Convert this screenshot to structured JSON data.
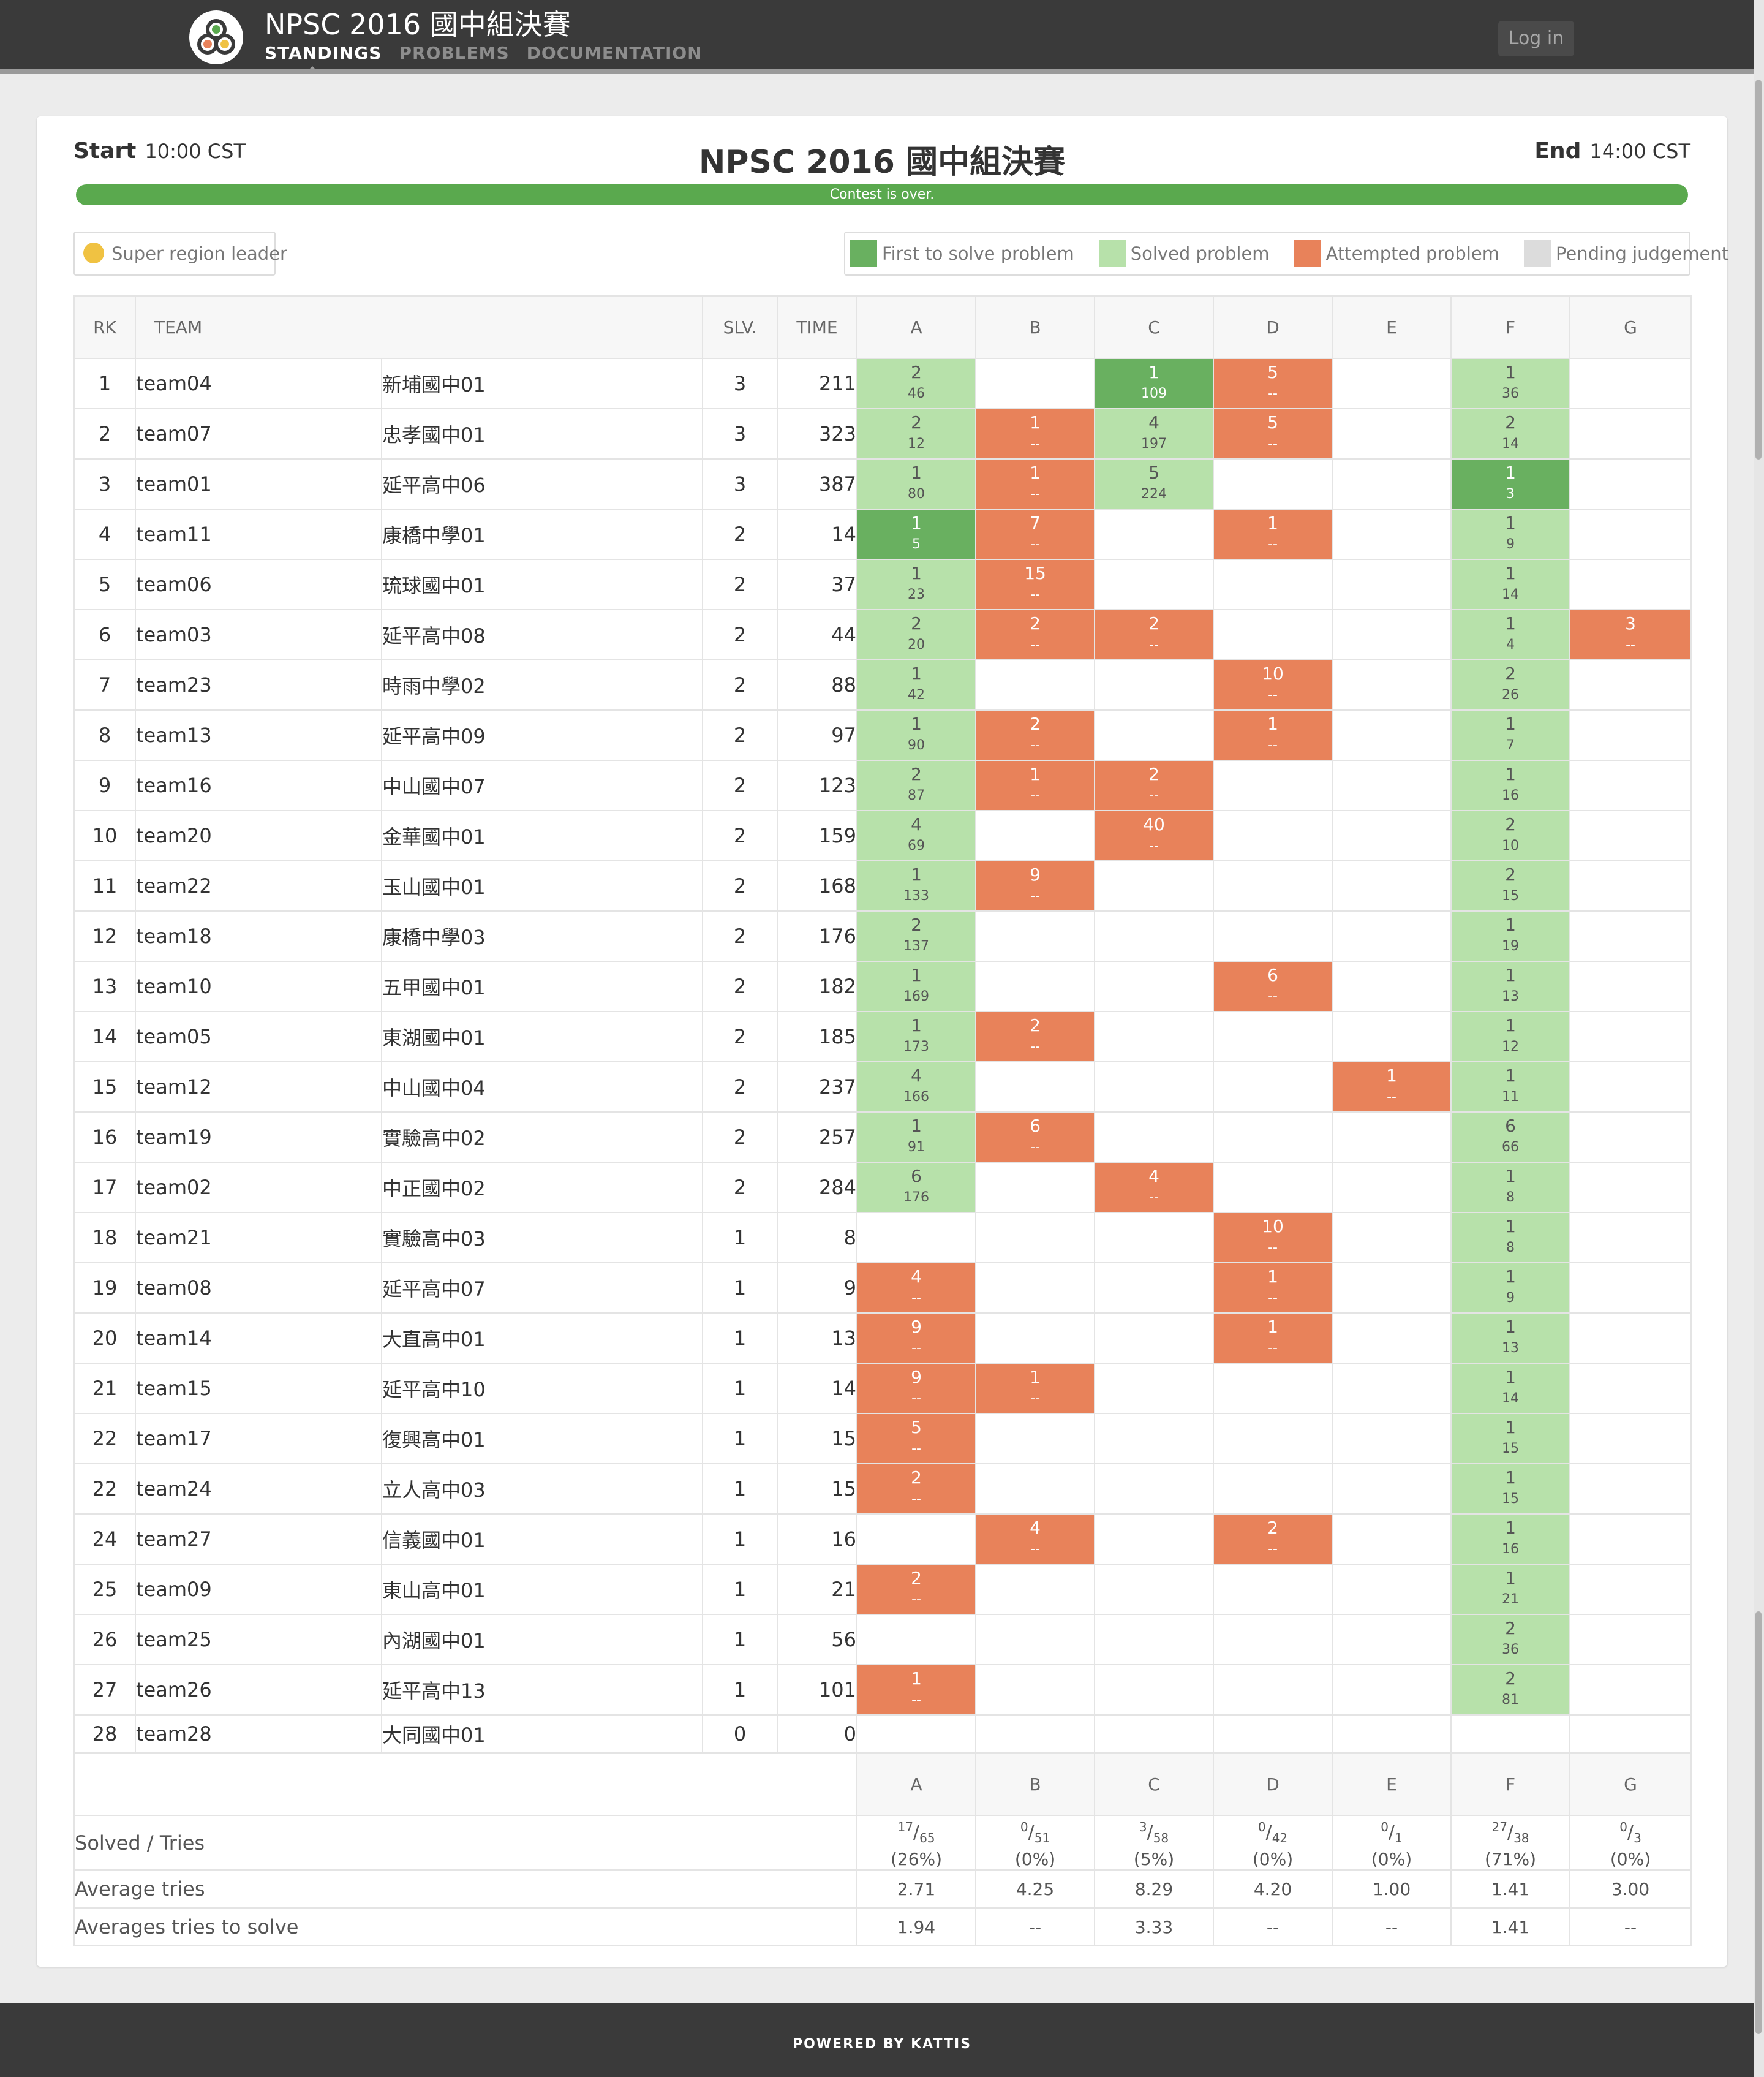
{
  "app": {
    "title": "NPSC 2016 國中組決賽",
    "nav": [
      "STANDINGS",
      "PROBLEMS",
      "DOCUMENTATION"
    ],
    "login": "Log in",
    "logo_icon": "kattis-logo-icon"
  },
  "contest": {
    "title": "NPSC 2016 國中組決賽",
    "start_label": "Start",
    "start_time": "10:00 CST",
    "end_label": "End",
    "end_time": "14:00 CST",
    "status": "Contest is over.",
    "progress_percent": 100
  },
  "legend": {
    "leader": "Super region leader",
    "first": "First to solve problem",
    "solved": "Solved problem",
    "attempted": "Attempted problem",
    "pending": "Pending judgement"
  },
  "colors": {
    "first": "#69b060",
    "solved": "#b7e1aa",
    "attempted": "#e8825a",
    "pending": "#dcdcdc",
    "leader": "#f0c242",
    "progress": "#5aa94e",
    "header": "#3a3a3a",
    "problem_link": "#4a8fd1"
  },
  "headers": {
    "rank": "RK",
    "team": "TEAM",
    "solved": "SLV.",
    "time": "TIME"
  },
  "problems": [
    "A",
    "B",
    "C",
    "D",
    "E",
    "F",
    "G"
  ],
  "rows": [
    {
      "rank": "1",
      "team": "team04",
      "name": "新埔國中01",
      "solved": "3",
      "time": "211",
      "cells": [
        [
          "solved",
          "2",
          "46"
        ],
        [
          "",
          "",
          ""
        ],
        [
          "first",
          "1",
          "109"
        ],
        [
          "att",
          "5",
          "--"
        ],
        [
          "",
          "",
          ""
        ],
        [
          "solved",
          "1",
          "36"
        ],
        [
          "",
          "",
          ""
        ]
      ]
    },
    {
      "rank": "2",
      "team": "team07",
      "name": "忠孝國中01",
      "solved": "3",
      "time": "323",
      "cells": [
        [
          "solved",
          "2",
          "12"
        ],
        [
          "att",
          "1",
          "--"
        ],
        [
          "solved",
          "4",
          "197"
        ],
        [
          "att",
          "5",
          "--"
        ],
        [
          "",
          "",
          ""
        ],
        [
          "solved",
          "2",
          "14"
        ],
        [
          "",
          "",
          ""
        ]
      ]
    },
    {
      "rank": "3",
      "team": "team01",
      "name": "延平高中06",
      "solved": "3",
      "time": "387",
      "cells": [
        [
          "solved",
          "1",
          "80"
        ],
        [
          "att",
          "1",
          "--"
        ],
        [
          "solved",
          "5",
          "224"
        ],
        [
          "",
          "",
          ""
        ],
        [
          "",
          "",
          ""
        ],
        [
          "first",
          "1",
          "3"
        ],
        [
          "",
          "",
          ""
        ]
      ]
    },
    {
      "rank": "4",
      "team": "team11",
      "name": "康橋中學01",
      "solved": "2",
      "time": "14",
      "cells": [
        [
          "first",
          "1",
          "5"
        ],
        [
          "att",
          "7",
          "--"
        ],
        [
          "",
          "",
          ""
        ],
        [
          "att",
          "1",
          "--"
        ],
        [
          "",
          "",
          ""
        ],
        [
          "solved",
          "1",
          "9"
        ],
        [
          "",
          "",
          ""
        ]
      ]
    },
    {
      "rank": "5",
      "team": "team06",
      "name": "琉球國中01",
      "solved": "2",
      "time": "37",
      "cells": [
        [
          "solved",
          "1",
          "23"
        ],
        [
          "att",
          "15",
          "--"
        ],
        [
          "",
          "",
          ""
        ],
        [
          "",
          "",
          ""
        ],
        [
          "",
          "",
          ""
        ],
        [
          "solved",
          "1",
          "14"
        ],
        [
          "",
          "",
          ""
        ]
      ]
    },
    {
      "rank": "6",
      "team": "team03",
      "name": "延平高中08",
      "solved": "2",
      "time": "44",
      "cells": [
        [
          "solved",
          "2",
          "20"
        ],
        [
          "att",
          "2",
          "--"
        ],
        [
          "att",
          "2",
          "--"
        ],
        [
          "",
          "",
          ""
        ],
        [
          "",
          "",
          ""
        ],
        [
          "solved",
          "1",
          "4"
        ],
        [
          "att",
          "3",
          "--"
        ]
      ]
    },
    {
      "rank": "7",
      "team": "team23",
      "name": "時雨中學02",
      "solved": "2",
      "time": "88",
      "cells": [
        [
          "solved",
          "1",
          "42"
        ],
        [
          "",
          "",
          ""
        ],
        [
          "",
          "",
          ""
        ],
        [
          "att",
          "10",
          "--"
        ],
        [
          "",
          "",
          ""
        ],
        [
          "solved",
          "2",
          "26"
        ],
        [
          "",
          "",
          ""
        ]
      ]
    },
    {
      "rank": "8",
      "team": "team13",
      "name": "延平高中09",
      "solved": "2",
      "time": "97",
      "cells": [
        [
          "solved",
          "1",
          "90"
        ],
        [
          "att",
          "2",
          "--"
        ],
        [
          "",
          "",
          ""
        ],
        [
          "att",
          "1",
          "--"
        ],
        [
          "",
          "",
          ""
        ],
        [
          "solved",
          "1",
          "7"
        ],
        [
          "",
          "",
          ""
        ]
      ]
    },
    {
      "rank": "9",
      "team": "team16",
      "name": "中山國中07",
      "solved": "2",
      "time": "123",
      "cells": [
        [
          "solved",
          "2",
          "87"
        ],
        [
          "att",
          "1",
          "--"
        ],
        [
          "att",
          "2",
          "--"
        ],
        [
          "",
          "",
          ""
        ],
        [
          "",
          "",
          ""
        ],
        [
          "solved",
          "1",
          "16"
        ],
        [
          "",
          "",
          ""
        ]
      ]
    },
    {
      "rank": "10",
      "team": "team20",
      "name": "金華國中01",
      "solved": "2",
      "time": "159",
      "cells": [
        [
          "solved",
          "4",
          "69"
        ],
        [
          "",
          "",
          ""
        ],
        [
          "att",
          "40",
          "--"
        ],
        [
          "",
          "",
          ""
        ],
        [
          "",
          "",
          ""
        ],
        [
          "solved",
          "2",
          "10"
        ],
        [
          "",
          "",
          ""
        ]
      ]
    },
    {
      "rank": "11",
      "team": "team22",
      "name": "玉山國中01",
      "solved": "2",
      "time": "168",
      "cells": [
        [
          "solved",
          "1",
          "133"
        ],
        [
          "att",
          "9",
          "--"
        ],
        [
          "",
          "",
          ""
        ],
        [
          "",
          "",
          ""
        ],
        [
          "",
          "",
          ""
        ],
        [
          "solved",
          "2",
          "15"
        ],
        [
          "",
          "",
          ""
        ]
      ]
    },
    {
      "rank": "12",
      "team": "team18",
      "name": "康橋中學03",
      "solved": "2",
      "time": "176",
      "cells": [
        [
          "solved",
          "2",
          "137"
        ],
        [
          "",
          "",
          ""
        ],
        [
          "",
          "",
          ""
        ],
        [
          "",
          "",
          ""
        ],
        [
          "",
          "",
          ""
        ],
        [
          "solved",
          "1",
          "19"
        ],
        [
          "",
          "",
          ""
        ]
      ]
    },
    {
      "rank": "13",
      "team": "team10",
      "name": "五甲國中01",
      "solved": "2",
      "time": "182",
      "cells": [
        [
          "solved",
          "1",
          "169"
        ],
        [
          "",
          "",
          ""
        ],
        [
          "",
          "",
          ""
        ],
        [
          "att",
          "6",
          "--"
        ],
        [
          "",
          "",
          ""
        ],
        [
          "solved",
          "1",
          "13"
        ],
        [
          "",
          "",
          ""
        ]
      ]
    },
    {
      "rank": "14",
      "team": "team05",
      "name": "東湖國中01",
      "solved": "2",
      "time": "185",
      "cells": [
        [
          "solved",
          "1",
          "173"
        ],
        [
          "att",
          "2",
          "--"
        ],
        [
          "",
          "",
          ""
        ],
        [
          "",
          "",
          ""
        ],
        [
          "",
          "",
          ""
        ],
        [
          "solved",
          "1",
          "12"
        ],
        [
          "",
          "",
          ""
        ]
      ]
    },
    {
      "rank": "15",
      "team": "team12",
      "name": "中山國中04",
      "solved": "2",
      "time": "237",
      "cells": [
        [
          "solved",
          "4",
          "166"
        ],
        [
          "",
          "",
          ""
        ],
        [
          "",
          "",
          ""
        ],
        [
          "",
          "",
          ""
        ],
        [
          "att",
          "1",
          "--"
        ],
        [
          "solved",
          "1",
          "11"
        ],
        [
          "",
          "",
          ""
        ]
      ]
    },
    {
      "rank": "16",
      "team": "team19",
      "name": "實驗高中02",
      "solved": "2",
      "time": "257",
      "cells": [
        [
          "solved",
          "1",
          "91"
        ],
        [
          "att",
          "6",
          "--"
        ],
        [
          "",
          "",
          ""
        ],
        [
          "",
          "",
          ""
        ],
        [
          "",
          "",
          ""
        ],
        [
          "solved",
          "6",
          "66"
        ],
        [
          "",
          "",
          ""
        ]
      ]
    },
    {
      "rank": "17",
      "team": "team02",
      "name": "中正國中02",
      "solved": "2",
      "time": "284",
      "cells": [
        [
          "solved",
          "6",
          "176"
        ],
        [
          "",
          "",
          ""
        ],
        [
          "att",
          "4",
          "--"
        ],
        [
          "",
          "",
          ""
        ],
        [
          "",
          "",
          ""
        ],
        [
          "solved",
          "1",
          "8"
        ],
        [
          "",
          "",
          ""
        ]
      ]
    },
    {
      "rank": "18",
      "team": "team21",
      "name": "實驗高中03",
      "solved": "1",
      "time": "8",
      "cells": [
        [
          "",
          "",
          ""
        ],
        [
          "",
          "",
          ""
        ],
        [
          "",
          "",
          ""
        ],
        [
          "att",
          "10",
          "--"
        ],
        [
          "",
          "",
          ""
        ],
        [
          "solved",
          "1",
          "8"
        ],
        [
          "",
          "",
          ""
        ]
      ]
    },
    {
      "rank": "19",
      "team": "team08",
      "name": "延平高中07",
      "solved": "1",
      "time": "9",
      "cells": [
        [
          "att",
          "4",
          "--"
        ],
        [
          "",
          "",
          ""
        ],
        [
          "",
          "",
          ""
        ],
        [
          "att",
          "1",
          "--"
        ],
        [
          "",
          "",
          ""
        ],
        [
          "solved",
          "1",
          "9"
        ],
        [
          "",
          "",
          ""
        ]
      ]
    },
    {
      "rank": "20",
      "team": "team14",
      "name": "大直高中01",
      "solved": "1",
      "time": "13",
      "cells": [
        [
          "att",
          "9",
          "--"
        ],
        [
          "",
          "",
          ""
        ],
        [
          "",
          "",
          ""
        ],
        [
          "att",
          "1",
          "--"
        ],
        [
          "",
          "",
          ""
        ],
        [
          "solved",
          "1",
          "13"
        ],
        [
          "",
          "",
          ""
        ]
      ]
    },
    {
      "rank": "21",
      "team": "team15",
      "name": "延平高中10",
      "solved": "1",
      "time": "14",
      "cells": [
        [
          "att",
          "9",
          "--"
        ],
        [
          "att",
          "1",
          "--"
        ],
        [
          "",
          "",
          ""
        ],
        [
          "",
          "",
          ""
        ],
        [
          "",
          "",
          ""
        ],
        [
          "solved",
          "1",
          "14"
        ],
        [
          "",
          "",
          ""
        ]
      ]
    },
    {
      "rank": "22",
      "team": "team17",
      "name": "復興高中01",
      "solved": "1",
      "time": "15",
      "cells": [
        [
          "att",
          "5",
          "--"
        ],
        [
          "",
          "",
          ""
        ],
        [
          "",
          "",
          ""
        ],
        [
          "",
          "",
          ""
        ],
        [
          "",
          "",
          ""
        ],
        [
          "solved",
          "1",
          "15"
        ],
        [
          "",
          "",
          ""
        ]
      ]
    },
    {
      "rank": "22",
      "team": "team24",
      "name": "立人高中03",
      "solved": "1",
      "time": "15",
      "cells": [
        [
          "att",
          "2",
          "--"
        ],
        [
          "",
          "",
          ""
        ],
        [
          "",
          "",
          ""
        ],
        [
          "",
          "",
          ""
        ],
        [
          "",
          "",
          ""
        ],
        [
          "solved",
          "1",
          "15"
        ],
        [
          "",
          "",
          ""
        ]
      ]
    },
    {
      "rank": "24",
      "team": "team27",
      "name": "信義國中01",
      "solved": "1",
      "time": "16",
      "cells": [
        [
          "",
          "",
          ""
        ],
        [
          "att",
          "4",
          "--"
        ],
        [
          "",
          "",
          ""
        ],
        [
          "att",
          "2",
          "--"
        ],
        [
          "",
          "",
          ""
        ],
        [
          "solved",
          "1",
          "16"
        ],
        [
          "",
          "",
          ""
        ]
      ]
    },
    {
      "rank": "25",
      "team": "team09",
      "name": "東山高中01",
      "solved": "1",
      "time": "21",
      "cells": [
        [
          "att",
          "2",
          "--"
        ],
        [
          "",
          "",
          ""
        ],
        [
          "",
          "",
          ""
        ],
        [
          "",
          "",
          ""
        ],
        [
          "",
          "",
          ""
        ],
        [
          "solved",
          "1",
          "21"
        ],
        [
          "",
          "",
          ""
        ]
      ]
    },
    {
      "rank": "26",
      "team": "team25",
      "name": "內湖國中01",
      "solved": "1",
      "time": "56",
      "cells": [
        [
          "",
          "",
          ""
        ],
        [
          "",
          "",
          ""
        ],
        [
          "",
          "",
          ""
        ],
        [
          "",
          "",
          ""
        ],
        [
          "",
          "",
          ""
        ],
        [
          "solved",
          "2",
          "36"
        ],
        [
          "",
          "",
          ""
        ]
      ]
    },
    {
      "rank": "27",
      "team": "team26",
      "name": "延平高中13",
      "solved": "1",
      "time": "101",
      "cells": [
        [
          "att",
          "1",
          "--"
        ],
        [
          "",
          "",
          ""
        ],
        [
          "",
          "",
          ""
        ],
        [
          "",
          "",
          ""
        ],
        [
          "",
          "",
          ""
        ],
        [
          "solved",
          "2",
          "81"
        ],
        [
          "",
          "",
          ""
        ]
      ]
    },
    {
      "rank": "28",
      "team": "team28",
      "name": "大同國中01",
      "solved": "0",
      "time": "0",
      "cells": [
        [
          "",
          "",
          ""
        ],
        [
          "",
          "",
          ""
        ],
        [
          "",
          "",
          ""
        ],
        [
          "",
          "",
          ""
        ],
        [
          "",
          "",
          ""
        ],
        [
          "",
          "",
          ""
        ],
        [
          "",
          "",
          ""
        ]
      ]
    }
  ],
  "summary": {
    "solved_tries_label": "Solved / Tries",
    "avg_tries_label": "Average tries",
    "avg_solve_label": "Averages tries to solve",
    "stats": [
      {
        "solved": "17",
        "tries": "65",
        "pct": "(26%)",
        "avg": "2.71",
        "avg_solve": "1.94"
      },
      {
        "solved": "0",
        "tries": "51",
        "pct": "(0%)",
        "avg": "4.25",
        "avg_solve": "--"
      },
      {
        "solved": "3",
        "tries": "58",
        "pct": "(5%)",
        "avg": "8.29",
        "avg_solve": "3.33"
      },
      {
        "solved": "0",
        "tries": "42",
        "pct": "(0%)",
        "avg": "4.20",
        "avg_solve": "--"
      },
      {
        "solved": "0",
        "tries": "1",
        "pct": "(0%)",
        "avg": "1.00",
        "avg_solve": "--"
      },
      {
        "solved": "27",
        "tries": "38",
        "pct": "(71%)",
        "avg": "1.41",
        "avg_solve": "1.41"
      },
      {
        "solved": "0",
        "tries": "3",
        "pct": "(0%)",
        "avg": "3.00",
        "avg_solve": "--"
      }
    ]
  },
  "footer": "POWERED BY KATTIS"
}
